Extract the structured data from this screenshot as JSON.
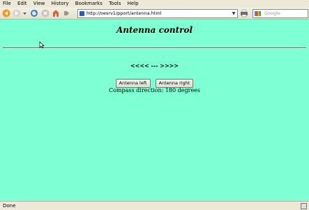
{
  "menu": {
    "items": [
      {
        "label": "File"
      },
      {
        "label": "Edit"
      },
      {
        "label": "View"
      },
      {
        "label": "History"
      },
      {
        "label": "Bookmarks"
      },
      {
        "label": "Tools"
      },
      {
        "label": "Help"
      }
    ]
  },
  "toolbar": {
    "url": "http://oesrv1/pport/antenna.html",
    "search_placeholder": "Google"
  },
  "page": {
    "title": "Antenna control",
    "arrows": "<<<< --- >>>>",
    "left_button": "Antenna left",
    "right_button": "Antenna right",
    "compass": "Compass direction: 180 degrees"
  },
  "status": {
    "text": "Done"
  }
}
